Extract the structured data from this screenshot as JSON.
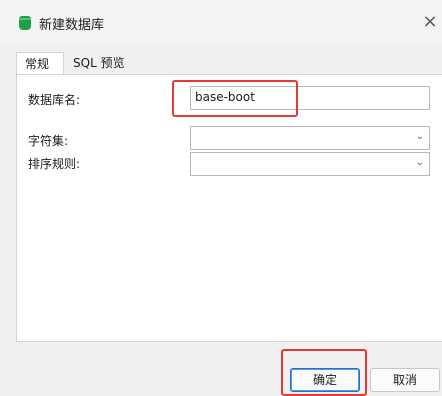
{
  "window": {
    "title": "新建数据库",
    "close_glyph": "×"
  },
  "tabs": [
    {
      "label": "常规",
      "active": true
    },
    {
      "label": "SQL 预览",
      "active": false
    }
  ],
  "form": {
    "db_name_label": "数据库名:",
    "db_name_value": "base-boot",
    "charset_label": "字符集:",
    "charset_value": "",
    "collation_label": "排序规则:",
    "collation_value": ""
  },
  "buttons": {
    "ok": "确定",
    "cancel": "取消"
  },
  "colors": {
    "accent": "#1e73c9",
    "highlight": "#e53935",
    "icon": "#1f9f4a"
  },
  "icons": {
    "app": "database-icon",
    "dropdown": "chevron-down-icon"
  }
}
